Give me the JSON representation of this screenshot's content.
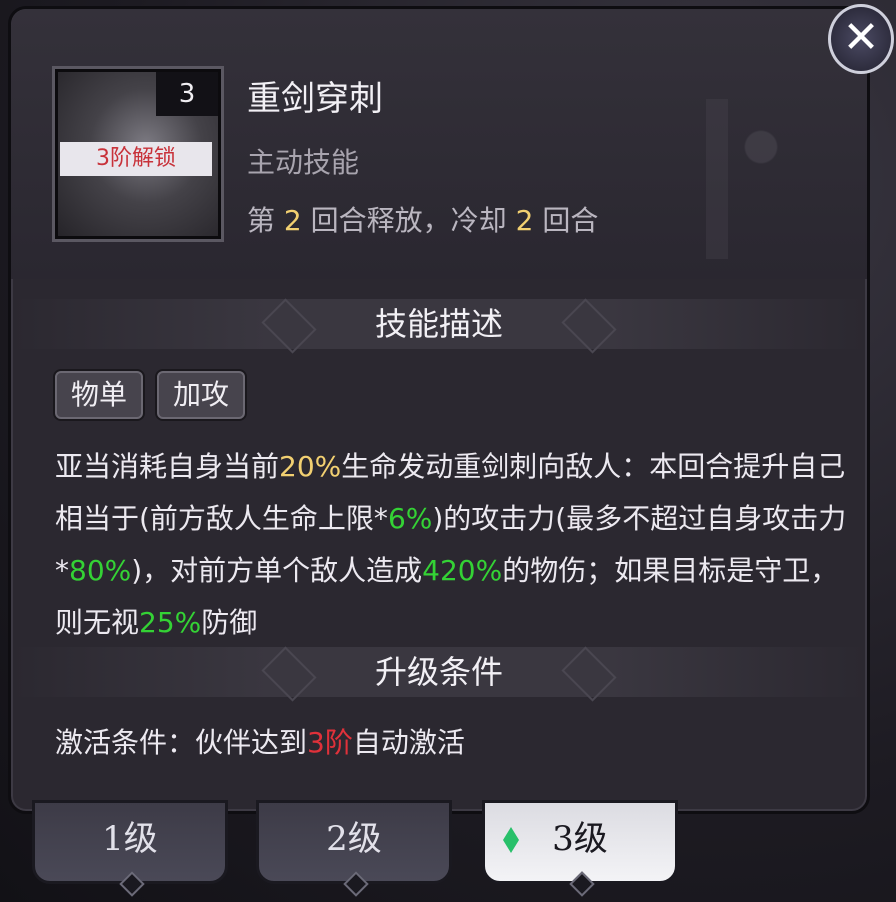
{
  "skill": {
    "level_badge": "3",
    "unlock_label": "3阶解锁",
    "name": "重剑穿刺",
    "type": "主动技能",
    "cd_prefix": "第",
    "cd_turn": "2",
    "cd_mid": "回合释放，冷却",
    "cd_value": "2",
    "cd_suffix": "回合"
  },
  "description": {
    "title": "技能描述",
    "tags": [
      "物单",
      "加攻"
    ],
    "t1": "亚当消耗自身当前",
    "v1": "20%",
    "t2": "生命发动重剑刺向敌人：本回合提升自己相当于(前方敌人生命上限*",
    "v2": "6%",
    "t3": ")的攻击力(最多不超过自身攻击力*",
    "v3": "80%",
    "t4": ")，对前方单个敌人造成",
    "v4": "420%",
    "t5": "的物伤；如果目标是守卫，则无视",
    "v5": "25%",
    "t6": "防御"
  },
  "upgrade": {
    "title": "升级条件",
    "c1": "激活条件：伙伴达到",
    "c2": "3阶",
    "c3": "自动激活"
  },
  "level_tabs": [
    "1级",
    "2级",
    "3级"
  ],
  "close_label": "✕",
  "colors": {
    "highlight_yellow": "#f2d071",
    "highlight_green": "#34d235",
    "highlight_red": "#e0313a"
  }
}
